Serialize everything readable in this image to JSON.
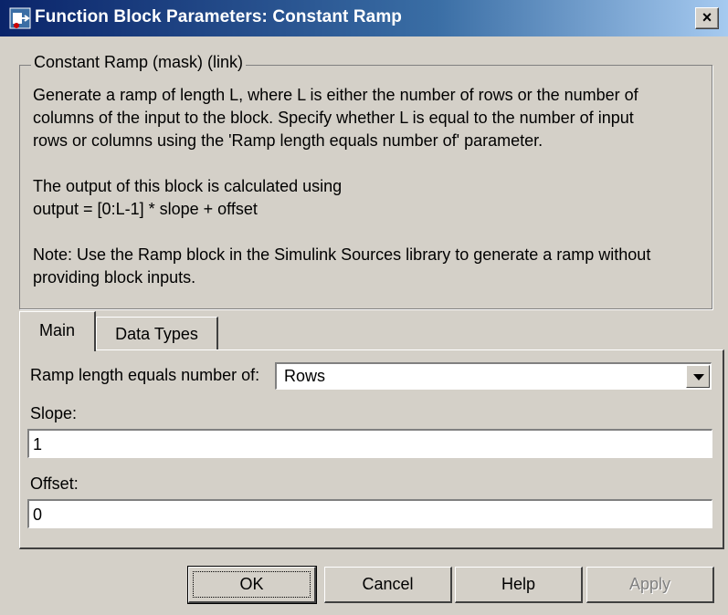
{
  "window": {
    "title": "Function Block Parameters: Constant Ramp",
    "close_glyph": "×"
  },
  "mask": {
    "legend": "Constant Ramp (mask) (link)",
    "description": "Generate a ramp of length L, where L is either the number of rows or the number of\ncolumns of the input to the block.  Specify whether L is equal to the number of input\nrows or columns using the 'Ramp length equals number of' parameter.\n\nThe output of this block is calculated using\noutput = [0:L-1] * slope + offset\n\nNote: Use the Ramp block in the Simulink Sources library to generate a ramp without\nproviding block inputs."
  },
  "tabs": [
    {
      "label": "Main",
      "active": true
    },
    {
      "label": "Data Types",
      "active": false
    }
  ],
  "params": {
    "ramp_length_label": "Ramp length equals number of:",
    "ramp_length_value": "Rows",
    "slope_label": "Slope:",
    "slope_value": "1",
    "offset_label": "Offset:",
    "offset_value": "0"
  },
  "buttons": {
    "ok": "OK",
    "cancel": "Cancel",
    "help": "Help",
    "apply": "Apply"
  },
  "colors": {
    "title_bar_start": "#0a246a",
    "title_bar_end": "#a6caf0",
    "dialog_face": "#d4d0c8"
  }
}
